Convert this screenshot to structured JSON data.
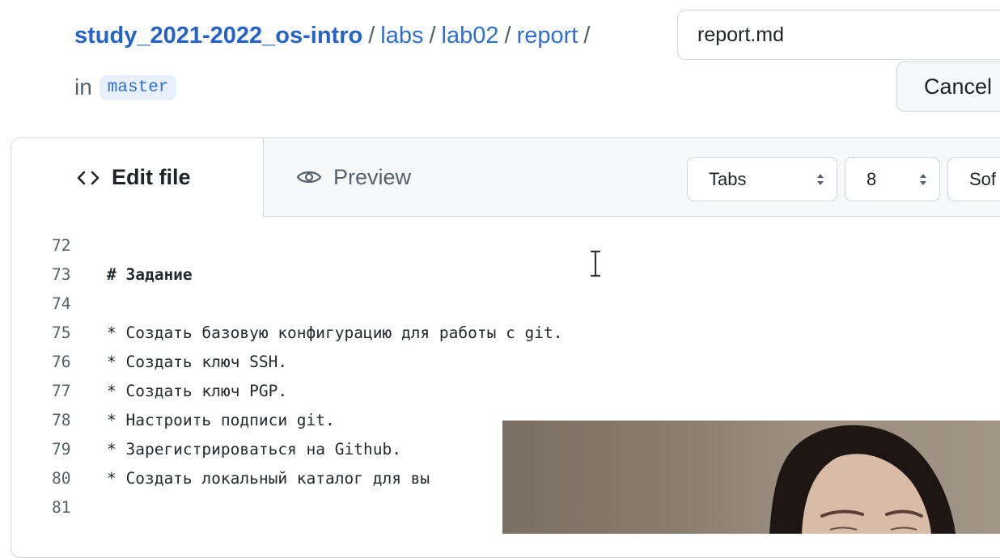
{
  "breadcrumb": {
    "repo": "study_2021-2022_os-intro",
    "parts": [
      "labs",
      "lab02",
      "report"
    ],
    "separator": "/"
  },
  "filename": {
    "value": "report.md"
  },
  "branch": {
    "prefix": "in",
    "name": "master"
  },
  "actions": {
    "cancel_label": "Cancel"
  },
  "editor": {
    "tabs": [
      {
        "label": "Edit file",
        "icon": "code-icon",
        "active": true
      },
      {
        "label": "Preview",
        "icon": "eye-icon",
        "active": false
      }
    ],
    "indent_mode": "Tabs",
    "indent_size": "8",
    "wrap_mode": "Sof"
  },
  "code_lines": [
    {
      "num": "72",
      "text": ""
    },
    {
      "num": "73",
      "text": "# Задание"
    },
    {
      "num": "74",
      "text": ""
    },
    {
      "num": "75",
      "text": "* Создать базовую конфигурацию для работы с git."
    },
    {
      "num": "76",
      "text": "* Создать ключ SSH."
    },
    {
      "num": "77",
      "text": "* Создать ключ PGP."
    },
    {
      "num": "78",
      "text": "* Настроить подписи git."
    },
    {
      "num": "79",
      "text": "* Зарегистрироваться на Github."
    },
    {
      "num": "80",
      "text": "* Создать локальный каталог для вы"
    },
    {
      "num": "81",
      "text": ""
    }
  ],
  "colors": {
    "link": "#2f6fd0",
    "header_bg": "#f6f8fa",
    "border": "#d0d7de"
  }
}
